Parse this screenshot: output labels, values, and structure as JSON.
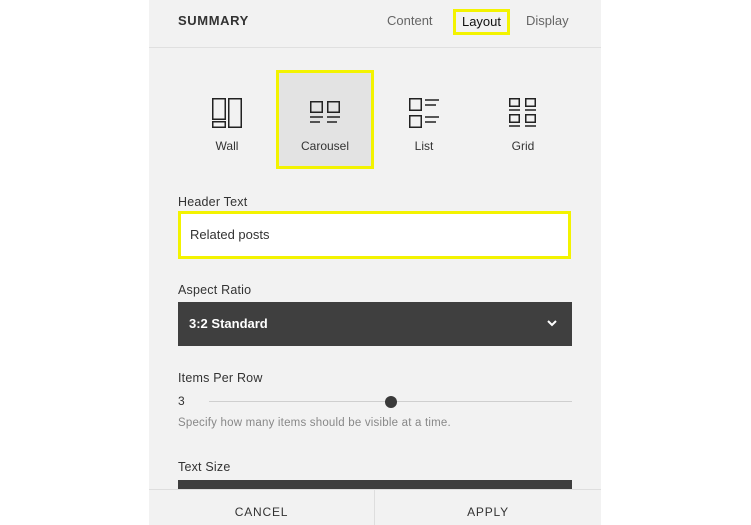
{
  "header": {
    "title": "SUMMARY",
    "tabs": [
      {
        "label": "Content"
      },
      {
        "label": "Layout",
        "active": true
      },
      {
        "label": "Display"
      }
    ]
  },
  "layouts": [
    {
      "label": "Wall",
      "icon": "wall-layout-icon"
    },
    {
      "label": "Carousel",
      "icon": "carousel-layout-icon",
      "selected": true
    },
    {
      "label": "List",
      "icon": "list-layout-icon"
    },
    {
      "label": "Grid",
      "icon": "grid-layout-icon"
    }
  ],
  "header_text": {
    "label": "Header Text",
    "value": "Related posts"
  },
  "aspect_ratio": {
    "label": "Aspect Ratio",
    "value": "3:2 Standard",
    "icon": "chevron-down-icon"
  },
  "items_per_row": {
    "label": "Items Per Row",
    "value": "3",
    "position_fraction": 0.5,
    "hint": "Specify how many items should be visible at a time."
  },
  "text_size": {
    "label": "Text Size"
  },
  "footer": {
    "cancel": "CANCEL",
    "apply": "APPLY"
  },
  "colors": {
    "highlight": "#f3f300",
    "panel": "#f2f2f2",
    "dark_control": "#3f3f3f"
  }
}
